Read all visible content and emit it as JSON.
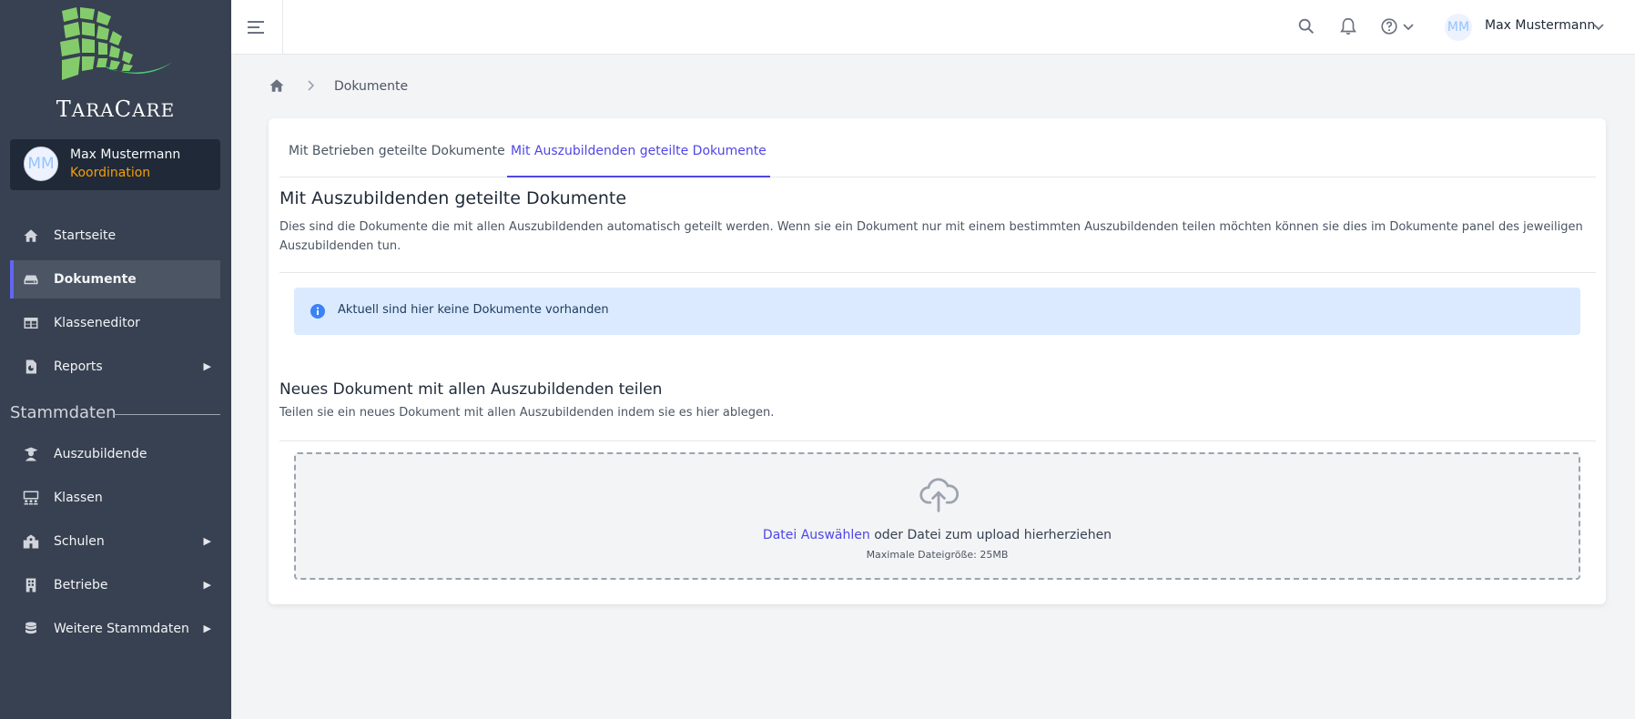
{
  "brand": {
    "name_first": "T",
    "name_rest": "ARA",
    "name_second": "C",
    "name_second_rest": "ARE"
  },
  "user": {
    "initials": "MM",
    "name": "Max Mustermann",
    "role": "Koordination"
  },
  "nav": {
    "items": [
      {
        "label": "Startseite",
        "icon": "home-icon"
      },
      {
        "label": "Dokumente",
        "icon": "drive-icon"
      },
      {
        "label": "Klasseneditor",
        "icon": "table-icon"
      },
      {
        "label": "Reports",
        "icon": "report-icon"
      }
    ],
    "section_title": "Stammdaten",
    "stammdaten_items": [
      {
        "label": "Auszubildende",
        "icon": "graduate-icon"
      },
      {
        "label": "Klassen",
        "icon": "classroom-icon"
      },
      {
        "label": "Schulen",
        "icon": "school-icon"
      },
      {
        "label": "Betriebe",
        "icon": "building-icon"
      },
      {
        "label": "Weitere Stammdaten",
        "icon": "database-icon"
      }
    ],
    "expand_glyph": "▶"
  },
  "topbar": {
    "user_initials": "MM",
    "user_name": "Max Mustermann"
  },
  "breadcrumb": {
    "current": "Dokumente"
  },
  "tabs": [
    {
      "label": "Mit Betrieben geteilte Dokumente"
    },
    {
      "label": "Mit Auszubildenden geteilte Dokumente"
    }
  ],
  "main": {
    "title": "Mit Auszubildenden geteilte Dokumente",
    "description": "Dies sind die Dokumente die mit allen Auszubildenden automatisch geteilt werden. Wenn sie ein Dokument nur mit einem bestimmten Auszubildenden teilen möchten können sie dies im Dokumente panel des jeweiligen Auszubildenden tun.",
    "info": "Aktuell sind hier keine Dokumente vorhanden",
    "upload_title": "Neues Dokument mit allen Auszubildenden teilen",
    "upload_desc": "Teilen sie ein neues Dokument mit allen Auszubildenden indem sie es hier ablegen.",
    "dropzone": {
      "link": "Datei Auswählen",
      "text": " oder Datei zum upload hierherziehen",
      "max": "Maximale Dateigröße: 25MB"
    }
  },
  "colors": {
    "sidebar": "#374151",
    "accent": "#4f46e5",
    "info_bg": "#dbeafe",
    "role": "#f59e0b"
  }
}
